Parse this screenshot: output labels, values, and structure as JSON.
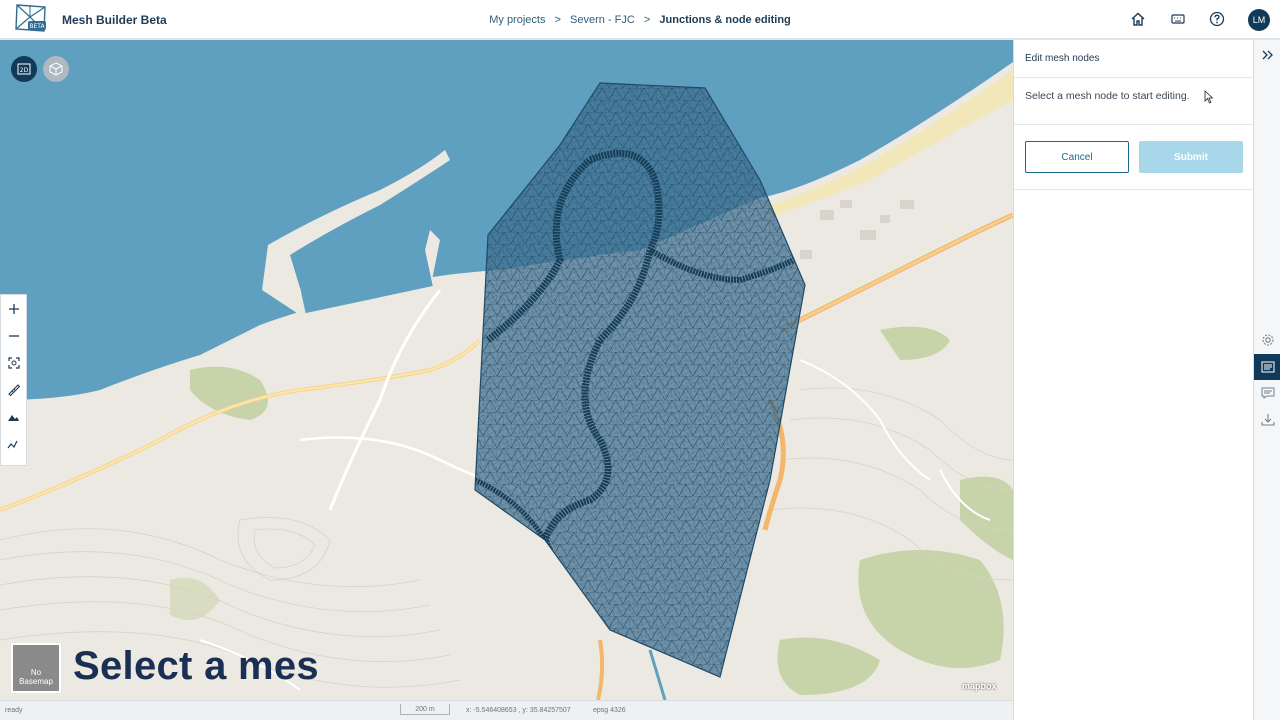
{
  "header": {
    "app_title": "Mesh Builder Beta",
    "logo_badge": "BETA",
    "breadcrumb": {
      "items": [
        "My projects",
        "Severn - FJC"
      ],
      "separator": ">",
      "current": "Junctions & node editing"
    },
    "icons": [
      "home-icon",
      "keyboard-icon",
      "help-icon"
    ],
    "avatar_initials": "LM"
  },
  "map": {
    "view_buttons": [
      {
        "name": "2D",
        "active": true
      },
      {
        "name": "3D",
        "active": false
      }
    ],
    "tools": [
      "zoom-in-icon",
      "zoom-out-icon",
      "fit-extent-icon",
      "measure-icon",
      "terrain-icon",
      "elevation-icon"
    ],
    "basemap_button_label": "No Basemap",
    "caption": "Select a mes",
    "attribution": "mapbox"
  },
  "status": {
    "ready": "ready",
    "scale": "200 m",
    "coords": "x: -5.546408653 , y: 35.84257507",
    "epsg": "epsg 4326"
  },
  "panel": {
    "title": "Edit mesh nodes",
    "message": "Select a mesh node to start editing.",
    "cancel_label": "Cancel",
    "submit_label": "Submit"
  },
  "rail": {
    "collapse_icon": "double-chevron-right-icon",
    "items": [
      {
        "icon": "settings-icon",
        "active": false
      },
      {
        "icon": "list-icon",
        "active": true
      },
      {
        "icon": "comment-icon",
        "active": false
      },
      {
        "icon": "download-icon",
        "active": false
      }
    ]
  },
  "colors": {
    "primary": "#103a57",
    "accent": "#176a8e",
    "sea": "#5f9fbf",
    "mesh": "#2a5a7a",
    "submit_disabled": "#a9d7ea"
  }
}
